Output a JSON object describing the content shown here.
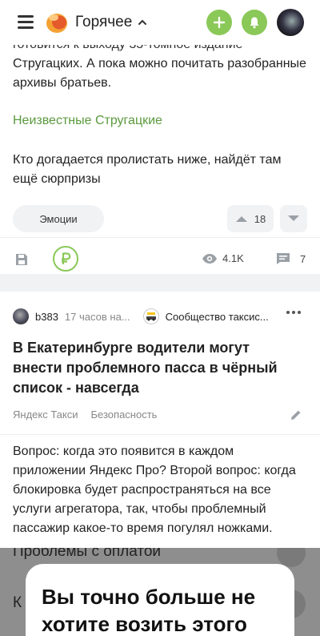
{
  "header": {
    "feed_title": "Горячее"
  },
  "post1": {
    "cut_text": "готовится к выходу 33-томное издание",
    "text_lines": "Стругацких. А пока можно почитать разобранные архивы братьев.",
    "link": "Неизвестные Стругацкие",
    "text2": "Кто догадается пролистать ниже, найдёт там ещё сюрпризы",
    "emotions_label": "Эмоции",
    "rating": "18",
    "views": "4.1K",
    "comments": "7"
  },
  "post2": {
    "author": "b383",
    "time": "17 часов на...",
    "community": "Сообщество таксис...",
    "title": "В Екатеринбурге водители могут внести проблемного пасса в чёрный список - навсегда",
    "tags": [
      "Яндекс Такси",
      "Безопасность"
    ],
    "text": "Вопрос: когда это появится в каждом приложении Яндекс Про? Второй вопрос: когда блокировка будет распространяться на все услуги агрегатора, так, чтобы проблемный пассажир какое-то время погулял ножками.",
    "embed_row1": "Проблемы с оплатой",
    "embed_row2": "К",
    "embed_dialog_title": "Вы точно больше не хотите возить этого"
  },
  "colors": {
    "accent_green": "#8ac858",
    "link_green": "#5b9a3e",
    "separator": "#f1f2f4"
  },
  "icons": [
    "menu-icon",
    "logo-icon",
    "chevron-up-icon",
    "plus-icon",
    "bell-icon",
    "arrow-up-icon",
    "arrow-down-icon",
    "save-icon",
    "ruble-icon",
    "eye-icon",
    "comment-icon",
    "more-icon",
    "pencil-icon"
  ]
}
